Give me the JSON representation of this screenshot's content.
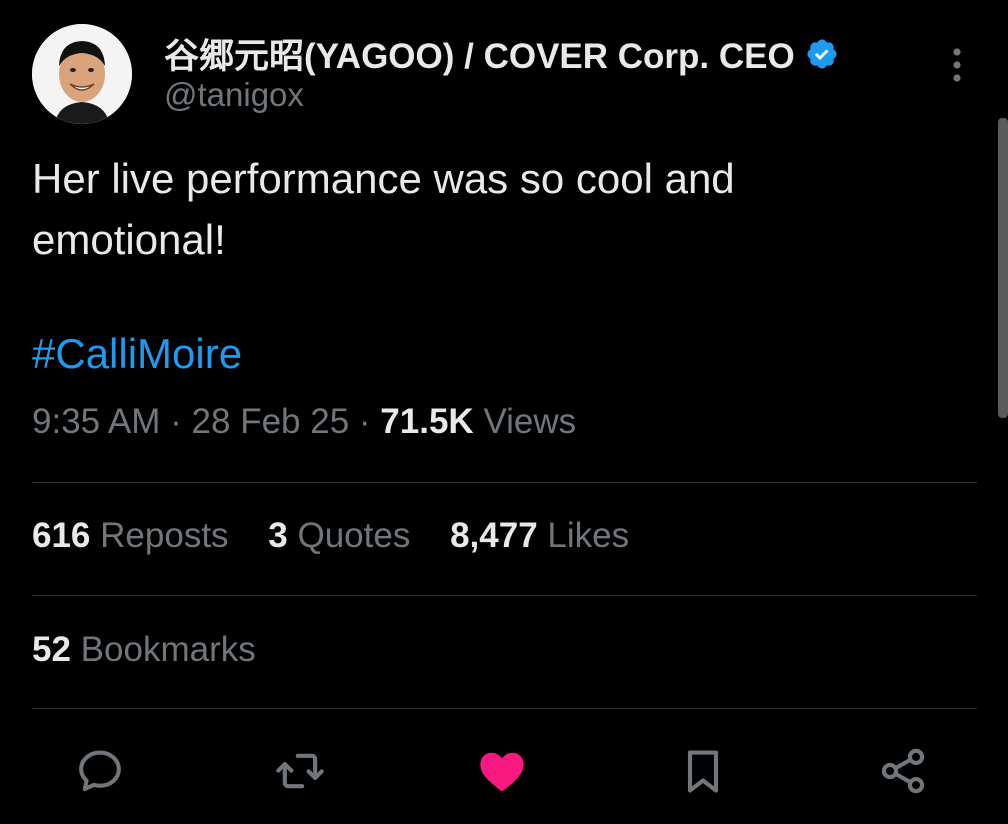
{
  "author": {
    "display_name": "谷郷元昭(YAGOO) / COVER Corp. CEO",
    "handle": "@tanigox",
    "verified": true,
    "verified_badge_color": "#1d9bf0"
  },
  "tweet": {
    "text": "Her live performance was so cool and\nemotional!",
    "hashtag": "#CalliMoire",
    "time": "9:35 AM",
    "separator": "·",
    "date": "28 Feb 25",
    "views_count": "71.5K",
    "views_label": "Views"
  },
  "stats": {
    "reposts": {
      "count": "616",
      "label": "Reposts"
    },
    "quotes": {
      "count": "3",
      "label": "Quotes"
    },
    "likes": {
      "count": "8,477",
      "label": "Likes"
    },
    "bookmarks": {
      "count": "52",
      "label": "Bookmarks"
    }
  },
  "actions": {
    "reply": {
      "icon": "speech-bubble-icon"
    },
    "repost": {
      "icon": "repost-arrows-icon"
    },
    "like": {
      "icon": "heart-icon",
      "active": true,
      "color": "#f91880"
    },
    "bookmark": {
      "icon": "bookmark-icon"
    },
    "share": {
      "icon": "share-icon"
    }
  },
  "colors": {
    "background": "#000000",
    "text_primary": "#e7e9ea",
    "text_secondary": "#71767b",
    "link": "#1d9bf0",
    "divider": "#2f3336"
  }
}
